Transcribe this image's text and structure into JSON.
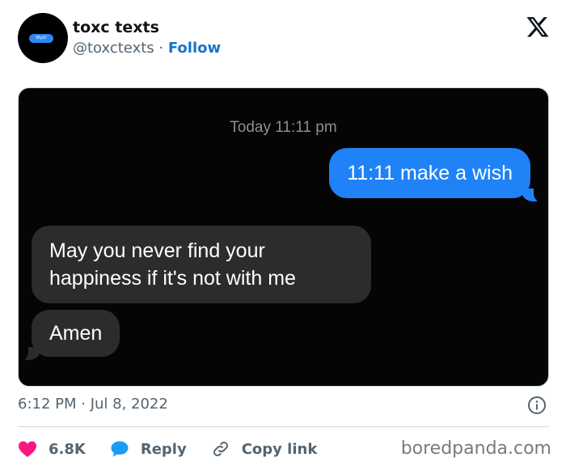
{
  "tweet": {
    "display_name": "toxc texts",
    "handle": "@toxctexts",
    "separator": "·",
    "follow_label": "Follow",
    "avatar_text": "Wyd?",
    "posted_at": "6:12 PM · Jul 8, 2022"
  },
  "conversation": {
    "timestamp": "Today 11:11 pm",
    "messages": [
      {
        "side": "sent",
        "text": "11:11 make a wish"
      },
      {
        "side": "received",
        "text": "May you never find your happiness if it's not with me"
      },
      {
        "side": "received",
        "text": "Amen"
      }
    ]
  },
  "actions": {
    "like_count": "6.8K",
    "reply_label": "Reply",
    "copy_link_label": "Copy link"
  },
  "watermark": "boredpanda.com",
  "colors": {
    "like": "#f91880",
    "reply": "#1d9bf0",
    "follow": "#1d72c9",
    "sent_bubble": "#1f82f7",
    "received_bubble": "#2c2c2e"
  },
  "icons": [
    "x-logo-icon",
    "info-icon",
    "heart-icon",
    "speech-bubble-icon",
    "link-icon"
  ]
}
